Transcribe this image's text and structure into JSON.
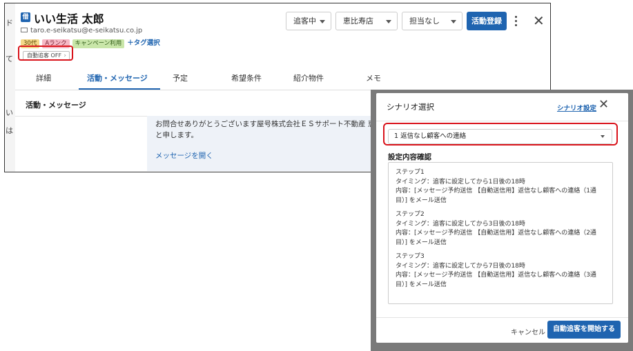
{
  "customer": {
    "icon_label": "借",
    "name": "いい生活 太郎",
    "email": "taro.e-seikatsu@e-seikatsu.co.jp",
    "tags": [
      "30代",
      "Aランク",
      "キャンペーン利用"
    ],
    "add_tag": "＋タグ選択",
    "auto_follow": "自動追客 OFF",
    "status_select": "追客中",
    "store_select": "恵比寿店",
    "assignee_select": "担当なし",
    "register_button": "活動登録"
  },
  "left_strip": [
    "ド",
    "て",
    "い",
    "は"
  ],
  "tabs": [
    "詳細",
    "活動・メッセージ",
    "予定",
    "希望条件",
    "紹介物件",
    "メモ"
  ],
  "active_tab": 1,
  "section": {
    "title": "活動・メッセージ",
    "message_line1": "お問合せありがとうございます屋号株式会社ＥＳサポート不動産 恵",
    "message_line2": "と申します。",
    "open_message": "メッセージを開く"
  },
  "modal": {
    "title": "シナリオ選択",
    "scenario_settings": "シナリオ設定",
    "selected_scenario": "1 返信なし顧客への連絡",
    "confirm_label": "設定内容確認",
    "steps": [
      {
        "name": "ステップ1",
        "timing": "タイミング：追客に設定してから1日後の18時",
        "content1": "内容：[メッセージ予約送信 【自動送信用】返信なし顧客への連絡（1通",
        "content2": "目）] をメール送信"
      },
      {
        "name": "ステップ2",
        "timing": "タイミング：追客に設定してから3日後の18時",
        "content1": "内容：[メッセージ予約送信 【自動送信用】返信なし顧客への連絡（2通",
        "content2": "目）] をメール送信"
      },
      {
        "name": "ステップ3",
        "timing": "タイミング：追客に設定してから7日後の18時",
        "content1": "内容：[メッセージ予約送信 【自動送信用】返信なし顧客への連絡（3通",
        "content2": "目）] をメール送信"
      }
    ],
    "cancel": "キャンセル",
    "start": "自動追客を開始する"
  },
  "colors": {
    "primary": "#1f64b0",
    "highlight_ring": "#d9121a"
  }
}
